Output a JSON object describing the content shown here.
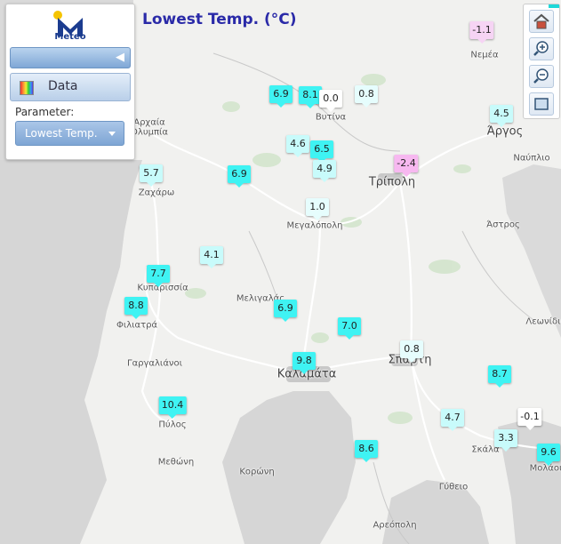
{
  "title": "Lowest Temp. (°C)",
  "panel": {
    "logo_text": "Meteo",
    "data_label": "Data",
    "parameter_label": "Parameter:",
    "parameter_value": "Lowest Temp.",
    "slider_icon": "back-arrow-icon",
    "data_icon": "palette-icon"
  },
  "zoom_controls": {
    "home_icon": "home-icon",
    "zoom_in_icon": "zoom-in-icon",
    "zoom_out_icon": "zoom-out-icon",
    "extent_icon": "zoom-extent-icon"
  },
  "colors": {
    "cyan": "#3ff3f3",
    "light_cyan": "#c8fbfb",
    "pale_cyan": "#e6fdfd",
    "white": "#ffffff",
    "pink": "#f7b8f0",
    "light_pink": "#f6d4f4",
    "title": "#2a2aa8"
  },
  "towns": [
    {
      "name": "Αρχαία",
      "big": false
    },
    {
      "name": "Ολυμπία",
      "big": false
    },
    {
      "name": "Νεμέα",
      "big": false
    },
    {
      "name": "Βυτίνα",
      "big": false
    },
    {
      "name": "Άργος",
      "big": true
    },
    {
      "name": "Ναύπλιο",
      "big": false
    },
    {
      "name": "Ζαχάρω",
      "big": false
    },
    {
      "name": "Τρίπολη",
      "big": true
    },
    {
      "name": "Μεγαλόπολη",
      "big": false
    },
    {
      "name": "Άστρος",
      "big": false
    },
    {
      "name": "Κυπαρισσία",
      "big": false
    },
    {
      "name": "Μελιγαλάς",
      "big": false
    },
    {
      "name": "Φιλιατρά",
      "big": false
    },
    {
      "name": "Λεωνίδιο",
      "big": false
    },
    {
      "name": "Γαργαλιάνοι",
      "big": false
    },
    {
      "name": "Σπάρτη",
      "big": true
    },
    {
      "name": "Καλαμάτα",
      "big": true
    },
    {
      "name": "Πύλος",
      "big": false
    },
    {
      "name": "Σκάλα",
      "big": false
    },
    {
      "name": "Μεθώνη",
      "big": false
    },
    {
      "name": "Κορώνη",
      "big": false
    },
    {
      "name": "Μολάοι",
      "big": false
    },
    {
      "name": "Γύθειο",
      "big": false
    },
    {
      "name": "Αρεόπολη",
      "big": false
    }
  ],
  "stations": [
    {
      "value": "-1.1",
      "color": "#f6d4f4"
    },
    {
      "value": "4.5",
      "color": "#c8fbfb"
    },
    {
      "value": "6.9",
      "color": "#3ff3f3"
    },
    {
      "value": "8.1",
      "color": "#3ff3f3"
    },
    {
      "value": "0.0",
      "color": "#ffffff"
    },
    {
      "value": "0.8",
      "color": "#e6fdfd"
    },
    {
      "value": "4.6",
      "color": "#c8fbfb"
    },
    {
      "value": "6.5",
      "color": "#3ff3f3"
    },
    {
      "value": "4.9",
      "color": "#c8fbfb"
    },
    {
      "value": "-2.4",
      "color": "#f7b8f0"
    },
    {
      "value": "5.7",
      "color": "#c8fbfb"
    },
    {
      "value": "6.9",
      "color": "#3ff3f3"
    },
    {
      "value": "1.0",
      "color": "#e6fdfd"
    },
    {
      "value": "4.1",
      "color": "#c8fbfb"
    },
    {
      "value": "7.7",
      "color": "#3ff3f3"
    },
    {
      "value": "8.8",
      "color": "#3ff3f3"
    },
    {
      "value": "6.9",
      "color": "#3ff3f3"
    },
    {
      "value": "7.0",
      "color": "#3ff3f3"
    },
    {
      "value": "9.8",
      "color": "#3ff3f3"
    },
    {
      "value": "0.8",
      "color": "#e6fdfd"
    },
    {
      "value": "8.7",
      "color": "#3ff3f3"
    },
    {
      "value": "10.4",
      "color": "#3ff3f3"
    },
    {
      "value": "4.7",
      "color": "#c8fbfb"
    },
    {
      "value": "-0.1",
      "color": "#ffffff"
    },
    {
      "value": "3.3",
      "color": "#c8fbfb"
    },
    {
      "value": "8.6",
      "color": "#3ff3f3"
    },
    {
      "value": "9.6",
      "color": "#3ff3f3"
    }
  ]
}
